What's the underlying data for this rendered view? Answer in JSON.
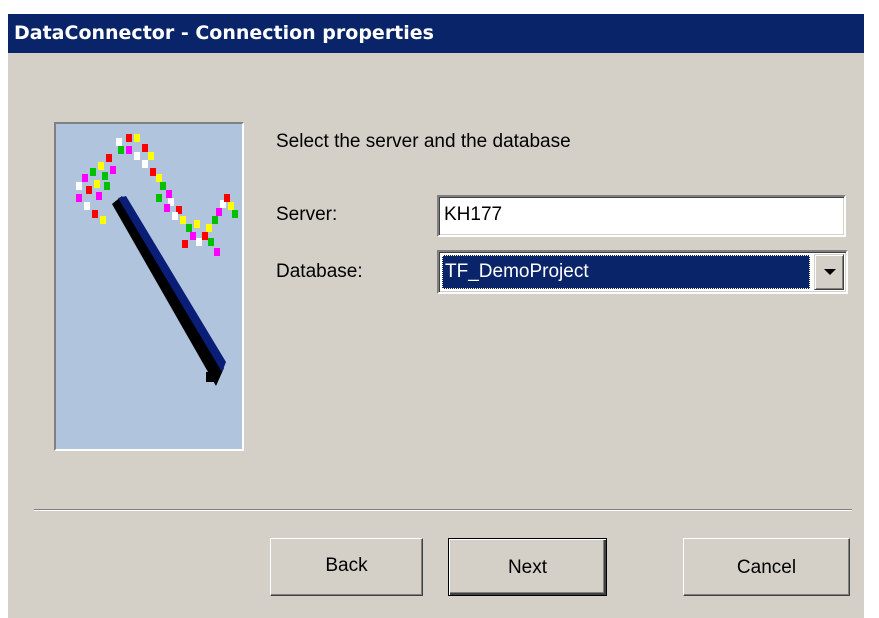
{
  "window": {
    "title": "DataConnector - Connection properties"
  },
  "wizard_image": {
    "icon": "data-wand-icon",
    "background": "#b0c4de"
  },
  "main": {
    "prompt": "Select the server and the database",
    "server_label": "Server:",
    "server_value": "KH177",
    "database_label": "Database:",
    "database_value": "TF_DemoProject"
  },
  "buttons": {
    "back": "Back",
    "next": "Next",
    "cancel": "Cancel"
  },
  "colors": {
    "titlebar": "#0a246a",
    "dialog_face": "#d4d0c8",
    "selection": "#0a246a"
  }
}
